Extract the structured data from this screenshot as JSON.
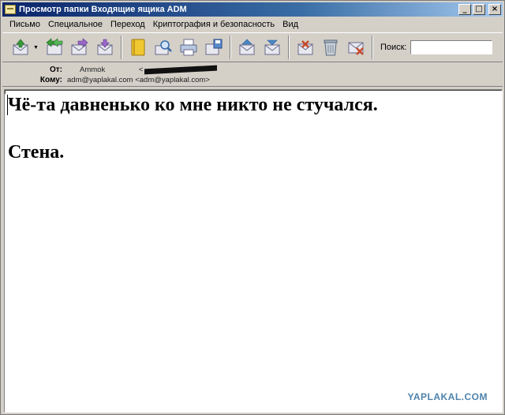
{
  "window": {
    "title": "Просмотр папки Входящие ящика ADM",
    "controls": {
      "minimize": "_",
      "maximize": "□",
      "close": "×"
    }
  },
  "menubar": {
    "items": [
      "Письмо",
      "Специальное",
      "Переход",
      "Криптография и безопасность",
      "Вид"
    ]
  },
  "toolbar": {
    "search_label": "Поиск:",
    "search_value": "",
    "buttons": [
      {
        "icon": "get-mail-icon",
        "color": "#3a9a3a"
      },
      {
        "icon": "reply-all-icon",
        "color": "#3a9a3a"
      },
      {
        "icon": "forward-icon",
        "color": "#7a4aa8"
      },
      {
        "icon": "new-message-icon",
        "color": "#7a4aa8"
      },
      {
        "icon": "address-book-icon",
        "color": "#d8a818"
      },
      {
        "icon": "find-icon",
        "color": "#5a8ac8"
      },
      {
        "icon": "print-icon",
        "color": "#5a8ac8"
      },
      {
        "icon": "save-icon",
        "color": "#5a8ac8"
      },
      {
        "icon": "previous-icon",
        "color": "#4a88c8"
      },
      {
        "icon": "next-icon",
        "color": "#4a88c8"
      },
      {
        "icon": "mark-spam-icon",
        "color": "#c84a2a"
      },
      {
        "icon": "delete-icon",
        "color": "#7a8a9a"
      },
      {
        "icon": "delete-message-icon",
        "color": "#c84a2a"
      }
    ]
  },
  "headers": {
    "from_label": "От:",
    "from_name": "Ammok",
    "from_addr_prefix": "<",
    "to_label": "Кому:",
    "to_value": "adm@yaplakal.com <adm@yaplakal.com>"
  },
  "message": {
    "line1": "Чё-та давненько ко мне никто не стучался.",
    "line2": "Стена."
  },
  "watermark": "YAPLAKAL.COM"
}
